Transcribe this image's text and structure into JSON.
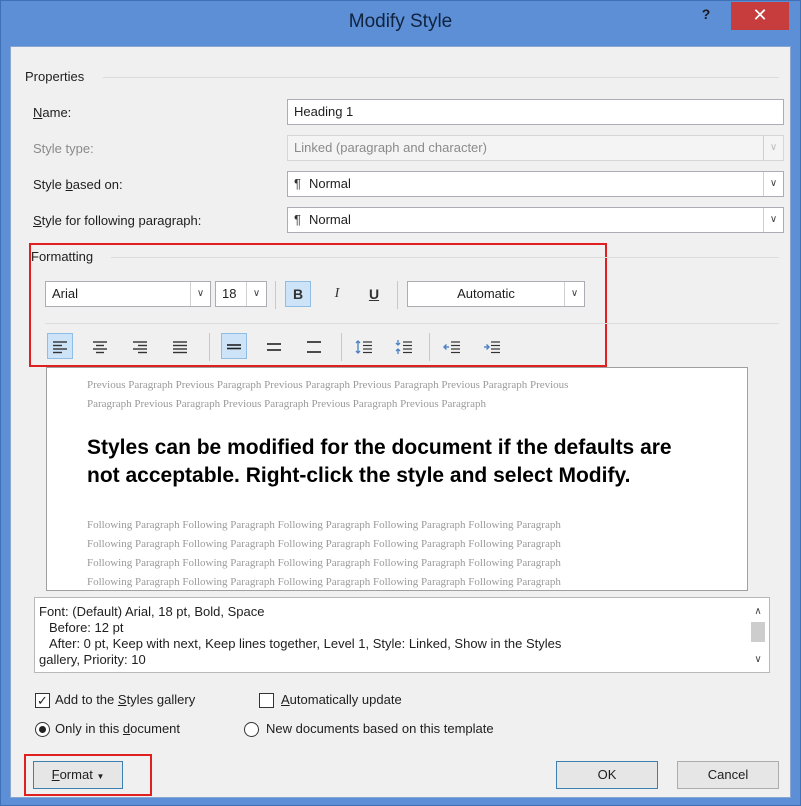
{
  "window": {
    "title": "Modify Style",
    "help_label": "?",
    "close_label": "✕"
  },
  "properties": {
    "section_label": "Properties",
    "name_label": "Name:",
    "name_value": "Heading 1",
    "style_type_label": "Style type:",
    "style_type_value": "Linked (paragraph and character)",
    "based_on_label": "Style based on:",
    "based_on_value": "Normal",
    "following_label": "Style for following paragraph:",
    "following_value": "Normal"
  },
  "formatting": {
    "section_label": "Formatting",
    "font": "Arial",
    "size": "18",
    "bold": "B",
    "italic": "I",
    "underline": "U",
    "color": "Automatic"
  },
  "preview": {
    "previous_lines": [
      "Previous Paragraph Previous Paragraph Previous Paragraph Previous Paragraph Previous Paragraph Previous",
      "Paragraph Previous Paragraph Previous Paragraph Previous Paragraph Previous Paragraph"
    ],
    "sample_text": "Styles can be modified for the document if the defaults are not acceptable. Right-click the style and select Modify.",
    "following_lines": [
      "Following Paragraph Following Paragraph Following Paragraph Following Paragraph Following Paragraph",
      "Following Paragraph Following Paragraph Following Paragraph Following Paragraph Following Paragraph",
      "Following Paragraph Following Paragraph Following Paragraph Following Paragraph Following Paragraph",
      "Following Paragraph Following Paragraph Following Paragraph Following Paragraph Following Paragraph"
    ]
  },
  "description": {
    "line1": "Font: (Default) Arial, 18 pt, Bold, Space",
    "line2": "Before:  12 pt",
    "line3": "After:  0 pt, Keep with next, Keep lines together, Level 1, Style: Linked, Show in the Styles",
    "line4": "gallery, Priority: 10"
  },
  "options": {
    "add_to_gallery_label": "Add to the Styles gallery",
    "auto_update_label": "Automatically update",
    "only_doc_label": "Only in this document",
    "new_docs_label": "New documents based on this template"
  },
  "buttons": {
    "format_label": "Format",
    "ok_label": "OK",
    "cancel_label": "Cancel"
  },
  "colors": {
    "title_bar": "#5c8fd6",
    "close_button": "#c73d3d",
    "highlight_box": "#e02020",
    "selected_button": "#cde3f7"
  }
}
